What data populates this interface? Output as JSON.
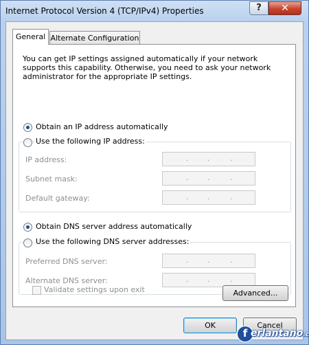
{
  "window": {
    "title": "Internet Protocol Version 4 (TCP/IPv4) Properties",
    "help_glyph": "?",
    "close_glyph": "✕"
  },
  "tabs": [
    {
      "label": "General",
      "active": true
    },
    {
      "label": "Alternate Configuration",
      "active": false
    }
  ],
  "description": "You can get IP settings assigned automatically if your network supports this capability. Otherwise, you need to ask your network administrator for the appropriate IP settings.",
  "ip_section": {
    "auto_label": "Obtain an IP address automatically",
    "manual_label": "Use the following IP address:",
    "auto_selected": true,
    "fields": [
      {
        "label": "IP address:",
        "value": ". . ."
      },
      {
        "label": "Subnet mask:",
        "value": ". . ."
      },
      {
        "label": "Default gateway:",
        "value": ". . ."
      }
    ]
  },
  "dns_section": {
    "auto_label": "Obtain DNS server address automatically",
    "manual_label": "Use the following DNS server addresses:",
    "auto_selected": true,
    "fields": [
      {
        "label": "Preferred DNS server:",
        "value": ". . ."
      },
      {
        "label": "Alternate DNS server:",
        "value": ". . ."
      }
    ]
  },
  "validate_label": "Validate settings upon exit",
  "validate_checked": false,
  "buttons": {
    "advanced": "Advanced...",
    "ok": "OK",
    "cancel": "Cancel"
  },
  "watermark": {
    "initial": "f",
    "text": "erlantano",
    "tld": ".com"
  }
}
